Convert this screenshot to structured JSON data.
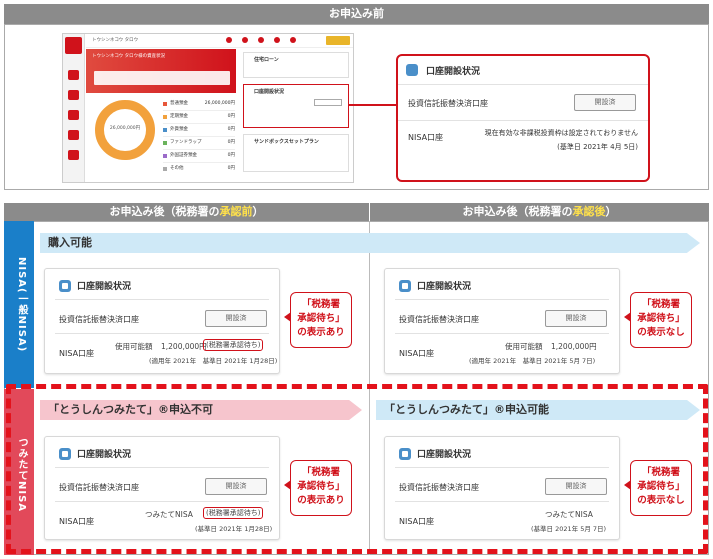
{
  "before": {
    "header": "お申込み前"
  },
  "thumb": {
    "brand": "トウシンネコウ タロウ",
    "top_label": "トップ",
    "hello_text": "トウシンネコウ タロウ様の資産状況",
    "mortgage": "住宅ローン",
    "account_status": "口座開設状況",
    "tsumitate": "サンドボックスセットプラン",
    "legend": [
      "普通預金",
      "定期預金",
      "外貨預金",
      "ファンドラップ",
      "外国証券預金",
      "その他"
    ],
    "legend_vals": [
      "26,000,000円",
      "0円",
      "0円",
      "0円",
      "0円",
      "0円"
    ],
    "colors": [
      "#e7563a",
      "#f2a13c",
      "#4a8fc9",
      "#6bb35c",
      "#9b6bc9",
      "#aaaaaa"
    ],
    "donut_total": "26,000,000円"
  },
  "zoom": {
    "title": "口座開設状況",
    "row1_label": "投資信託振替決済口座",
    "row1_btn": "開設済",
    "row2_label": "NISA口座",
    "row2_text": "現在有効な非課税投資枠は設定されておりません",
    "row2_date": "(基準日 2021年 4月 5日)"
  },
  "after": {
    "left_header_pre": "お申込み後（税務署の",
    "left_header_hl": "承認前",
    "left_header_post": "）",
    "right_header_pre": "お申込み後（税務署の",
    "right_header_hl": "承認後",
    "right_header_post": "）"
  },
  "nisa": {
    "side_label": "NISA(一般NISA)",
    "banner": "購入可能",
    "left_card": {
      "title": "口座開設状況",
      "row1_label": "投資信託振替決済口座",
      "row1_btn": "開設済",
      "row2_label": "NISA口座",
      "amount_label": "使用可能額",
      "amount": "1,200,000円",
      "pending": "(税務署承認待ち)",
      "date": "(適用年 2021年　基準日 2021年 1月28日)"
    },
    "right_card": {
      "title": "口座開設状況",
      "row1_label": "投資信託振替決済口座",
      "row1_btn": "開設済",
      "row2_label": "NISA口座",
      "amount_label": "使用可能額",
      "amount": "1,200,000円",
      "date": "(適用年 2021年　基準日 2021年 5月 7日)"
    },
    "callout_left": [
      "「税務署",
      "承認待ち」",
      "の表示あり"
    ],
    "callout_right": [
      "「税務署",
      "承認待ち」",
      "の表示なし"
    ]
  },
  "tsumitate_nisa": {
    "side_label": "つみたてNISA",
    "banner_left": "「とうしんつみたて」®申込不可",
    "banner_right": "「とうしんつみたて」®申込可能",
    "left_card": {
      "title": "口座開設状況",
      "row1_label": "投資信託振替決済口座",
      "row1_btn": "開設済",
      "row2_label": "NISA口座",
      "kind": "つみたてNISA",
      "pending": "(税務署承認待ち)",
      "date": "(基準日 2021年 1月28日)"
    },
    "right_card": {
      "title": "口座開設状況",
      "row1_label": "投資信託振替決済口座",
      "row1_btn": "開設済",
      "row2_label": "NISA口座",
      "kind": "つみたてNISA",
      "date": "(基準日 2021年 5月 7日)"
    },
    "callout_left": [
      "「税務署",
      "承認待ち」",
      "の表示あり"
    ],
    "callout_right": [
      "「税務署",
      "承認待ち」",
      "の表示なし"
    ]
  }
}
